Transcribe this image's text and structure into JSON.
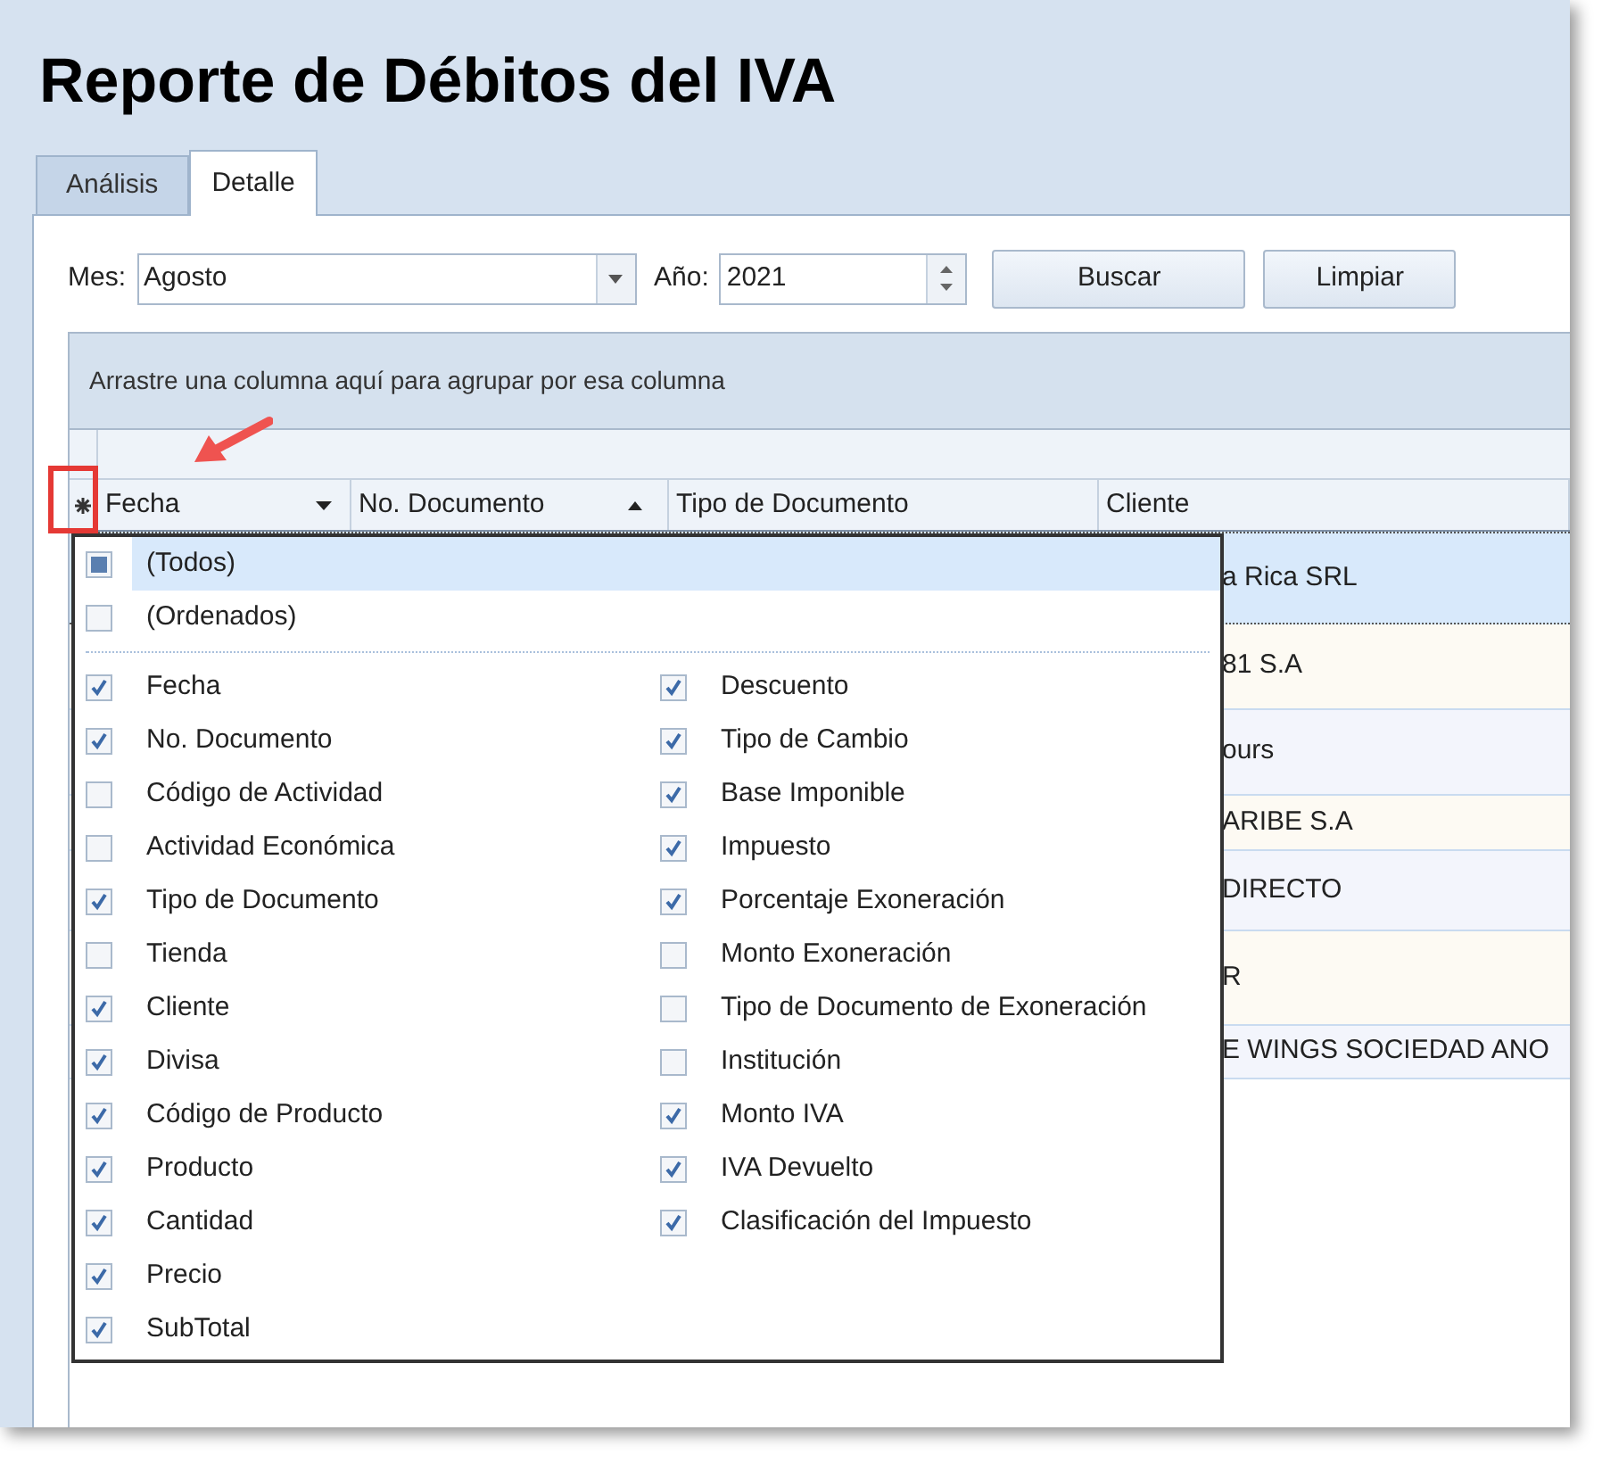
{
  "title": "Reporte de Débitos del IVA",
  "tabs": [
    {
      "label": "Análisis",
      "selected": false
    },
    {
      "label": "Detalle",
      "selected": true
    }
  ],
  "filters": {
    "month_label": "Mes:",
    "month": "Agosto",
    "year_label": "Año:",
    "year": "2021",
    "buttons": [
      "Buscar",
      "Limpiar"
    ]
  },
  "grid": {
    "group_hint": "Arrastre una columna aquí para agrupar por esa columna",
    "columns": [
      {
        "label": "Fecha",
        "filter": true,
        "sorted": false
      },
      {
        "label": "No. Documento",
        "filter": false,
        "sorted": true
      },
      {
        "label": "Tipo de Documento",
        "filter": false,
        "sorted": false
      },
      {
        "label": "Cliente",
        "filter": false,
        "sorted": false
      }
    ],
    "rows": [
      {
        "cliente": "a Rica SRL",
        "selected": true
      },
      {
        "cliente": "81 S.A",
        "selected": false
      },
      {
        "cliente": "ours",
        "selected": false
      },
      {
        "cliente": "ARIBE S.A",
        "selected": false
      },
      {
        "cliente": "DIRECTO",
        "selected": false
      },
      {
        "cliente": "R",
        "selected": false
      },
      {
        "cliente": "E WINGS SOCIEDAD ANO",
        "selected": false
      }
    ]
  },
  "column_chooser": {
    "special_items": [
      {
        "label": "(Todos)",
        "checked": false,
        "indeterminate": true,
        "selected": true
      },
      {
        "label": "(Ordenados)",
        "checked": false,
        "indeterminate": false,
        "selected": false
      }
    ],
    "columns_left": [
      {
        "label": "Fecha",
        "checked": true
      },
      {
        "label": "No. Documento",
        "checked": true
      },
      {
        "label": "Código de Actividad",
        "checked": false
      },
      {
        "label": "Actividad Económica",
        "checked": false
      },
      {
        "label": "Tipo de Documento",
        "checked": true
      },
      {
        "label": "Tienda",
        "checked": false
      },
      {
        "label": "Cliente",
        "checked": true
      },
      {
        "label": "Divisa",
        "checked": true
      },
      {
        "label": "Código de Producto",
        "checked": true
      },
      {
        "label": "Producto",
        "checked": true
      },
      {
        "label": "Cantidad",
        "checked": true
      },
      {
        "label": "Precio",
        "checked": true
      },
      {
        "label": "SubTotal",
        "checked": true
      }
    ],
    "columns_right": [
      {
        "label": "Descuento",
        "checked": true
      },
      {
        "label": "Tipo de Cambio",
        "checked": true
      },
      {
        "label": "Base Imponible",
        "checked": true
      },
      {
        "label": "Impuesto",
        "checked": true
      },
      {
        "label": "Porcentaje Exoneración",
        "checked": true
      },
      {
        "label": "Monto Exoneración",
        "checked": false
      },
      {
        "label": "Tipo de Documento de Exoneración",
        "checked": false
      },
      {
        "label": "Institución",
        "checked": false
      },
      {
        "label": "Monto IVA",
        "checked": true
      },
      {
        "label": "IVA Devuelto",
        "checked": true
      },
      {
        "label": "Clasificación del Impuesto",
        "checked": true
      }
    ]
  }
}
